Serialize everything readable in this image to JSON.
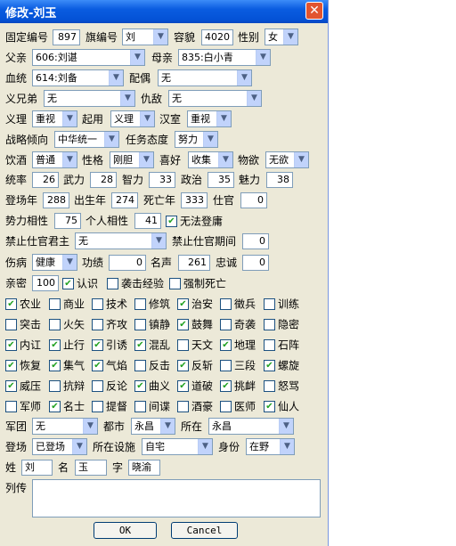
{
  "window": {
    "title": "修改-刘玉",
    "close_icon": "close-x-icon"
  },
  "row1": {
    "fixed_id_label": "固定编号",
    "fixed_id": "897",
    "flag_id_label": "旗编号",
    "flag_id": "刘",
    "appearance_label": "容貌",
    "appearance": "4020",
    "gender_label": "性别",
    "gender": "女"
  },
  "row2": {
    "father_label": "父亲",
    "father": "606:刘谌",
    "mother_label": "母亲",
    "mother": "835:白小青"
  },
  "row3": {
    "blood_label": "血统",
    "blood": "614:刘备",
    "spouse_label": "配偶",
    "spouse": "无"
  },
  "row4": {
    "sworn_label": "义兄弟",
    "sworn": "无",
    "enemy_label": "仇敌",
    "enemy": "无"
  },
  "row5": {
    "loyalty_label": "义理",
    "loyalty": "重视",
    "appoint_label": "起用",
    "appoint": "义理",
    "han_label": "汉室",
    "han": "重视"
  },
  "row6": {
    "strategy_label": "战略倾向",
    "strategy": "中华统一",
    "duty_label": "任务态度",
    "duty": "努力"
  },
  "row7": {
    "diet_label": "饮酒",
    "diet": "普通",
    "personality_label": "性格",
    "personality": "刚胆",
    "hobby_label": "喜好",
    "hobby": "收集",
    "desire_label": "物欲",
    "desire": "无欲"
  },
  "stats": {
    "lead_label": "统率",
    "lead": "26",
    "war_label": "武力",
    "war": "28",
    "int_label": "智力",
    "int": "33",
    "pol_label": "政治",
    "pol": "35",
    "cha_label": "魅力",
    "cha": "38"
  },
  "years": {
    "appear_label": "登场年",
    "appear": "288",
    "birth_label": "出生年",
    "birth": "274",
    "death_label": "死亡年",
    "death": "333",
    "office_label": "仕官",
    "office": "0"
  },
  "affinity": {
    "force_label": "势力相性",
    "force": "75",
    "personal_label": "个人相性",
    "personal": "41",
    "no_appear_label": "无法登庸"
  },
  "forbid": {
    "lord_label": "禁止仕官君主",
    "lord": "无",
    "period_label": "禁止仕官期间",
    "period": "0"
  },
  "injury": {
    "label": "伤病",
    "value": "健康",
    "merit_label": "功绩",
    "merit": "0",
    "fame_label": "名声",
    "fame": "261",
    "loyal_label": "忠诚",
    "loyal": "0"
  },
  "kin": {
    "label": "亲密",
    "value": "100",
    "recognize_label": "认识",
    "exp_label": "袭击经验",
    "forced_death_label": "强制死亡"
  },
  "skills": [
    {
      "label": "农业",
      "checked": true
    },
    {
      "label": "商业",
      "checked": false
    },
    {
      "label": "技术",
      "checked": false
    },
    {
      "label": "修筑",
      "checked": false
    },
    {
      "label": "治安",
      "checked": true
    },
    {
      "label": "徵兵",
      "checked": false
    },
    {
      "label": "训练",
      "checked": false
    },
    {
      "label": "突击",
      "checked": false
    },
    {
      "label": "火矢",
      "checked": false
    },
    {
      "label": "齐攻",
      "checked": false
    },
    {
      "label": "镇静",
      "checked": false
    },
    {
      "label": "鼓舞",
      "checked": true
    },
    {
      "label": "奇袭",
      "checked": false
    },
    {
      "label": "隐密",
      "checked": false
    },
    {
      "label": "内讧",
      "checked": true
    },
    {
      "label": "止行",
      "checked": true
    },
    {
      "label": "引诱",
      "checked": true
    },
    {
      "label": "混乱",
      "checked": true
    },
    {
      "label": "天文",
      "checked": false
    },
    {
      "label": "地理",
      "checked": true
    },
    {
      "label": "石阵",
      "checked": false
    },
    {
      "label": "恢复",
      "checked": true
    },
    {
      "label": "集气",
      "checked": true
    },
    {
      "label": "气焰",
      "checked": true
    },
    {
      "label": "反击",
      "checked": false
    },
    {
      "label": "反斩",
      "checked": true
    },
    {
      "label": "三段",
      "checked": false
    },
    {
      "label": "螺旋",
      "checked": true
    },
    {
      "label": "威压",
      "checked": true
    },
    {
      "label": "抗辩",
      "checked": false
    },
    {
      "label": "反论",
      "checked": false
    },
    {
      "label": "曲义",
      "checked": true
    },
    {
      "label": "道破",
      "checked": true
    },
    {
      "label": "挑衅",
      "checked": true
    },
    {
      "label": "怒骂",
      "checked": false
    },
    {
      "label": "军师",
      "checked": false
    },
    {
      "label": "名士",
      "checked": true
    },
    {
      "label": "提督",
      "checked": false
    },
    {
      "label": "间谍",
      "checked": false
    },
    {
      "label": "酒豪",
      "checked": false
    },
    {
      "label": "医师",
      "checked": false
    },
    {
      "label": "仙人",
      "checked": true
    }
  ],
  "army": {
    "label": "军团",
    "value": "无",
    "city_label": "都市",
    "city": "永昌",
    "at_label": "所在",
    "at": "永昌"
  },
  "status": {
    "label": "登场",
    "value": "已登场",
    "facility_label": "所在设施",
    "facility": "自宅",
    "rank_label": "身份",
    "rank": "在野"
  },
  "name": {
    "surname_label": "姓",
    "surname": "刘",
    "given_label": "名",
    "given": "玉",
    "style_label": "字",
    "style": "晓渝"
  },
  "bio": {
    "label": "列传",
    "text": ""
  },
  "buttons": {
    "ok": "OK",
    "cancel": "Cancel"
  },
  "colors": {
    "titlebar": "#0a5ce0",
    "dialog_bg": "#ece9d8",
    "check": "#21a121"
  }
}
